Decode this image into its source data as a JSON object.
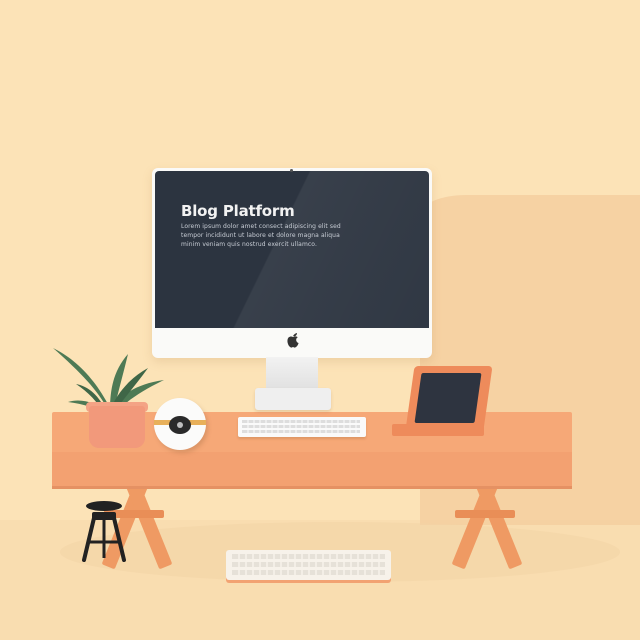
{
  "screen": {
    "title": "Blog Platform",
    "lines": [
      "Lorem ipsum dolor amet consect adipiscing elit sed",
      "tempor incididunt ut labore et dolore magna aliqua",
      "minim veniam quis nostrud exercit ullamco."
    ]
  },
  "colors": {
    "wall": "#FCE3B7",
    "desk": "#F6A877",
    "screen": "#2C3440",
    "accent": "#EE8B5B"
  },
  "icons": {
    "monitor_logo": "apple-logo-icon"
  }
}
